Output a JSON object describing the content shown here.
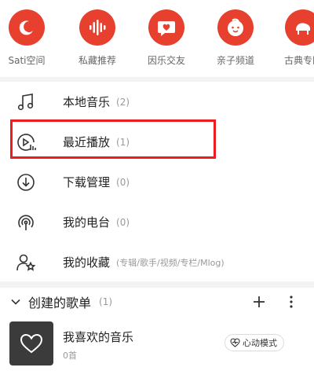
{
  "shortcuts": [
    {
      "label": "Sati空间",
      "icon": "sati-moon-icon"
    },
    {
      "label": "私藏推荐",
      "icon": "waveform-icon"
    },
    {
      "label": "因乐交友",
      "icon": "heart-chat-icon"
    },
    {
      "label": "亲子频道",
      "icon": "kid-face-icon"
    },
    {
      "label": "古典专区",
      "icon": "piano-icon"
    }
  ],
  "menu": {
    "local_music": {
      "title": "本地音乐",
      "count": "(2)",
      "icon": "music-note-icon"
    },
    "recent_play": {
      "title": "最近播放",
      "count": "(1)",
      "icon": "recent-play-icon"
    },
    "download": {
      "title": "下载管理",
      "count": "(0)",
      "icon": "download-icon"
    },
    "my_radio": {
      "title": "我的电台",
      "count": "(0)",
      "icon": "radio-icon"
    },
    "my_collection": {
      "title": "我的收藏",
      "sub": "(专辑/歌手/视频/专栏/Mlog)",
      "icon": "user-star-icon"
    }
  },
  "playlists": {
    "header_title": "创建的歌单",
    "header_count": "(1)",
    "items": [
      {
        "name": "我喜欢的音乐",
        "count": "0首",
        "mode_label": "心动模式"
      }
    ]
  },
  "colors": {
    "accent": "#e8402f",
    "highlight": "#ee1c1c"
  }
}
